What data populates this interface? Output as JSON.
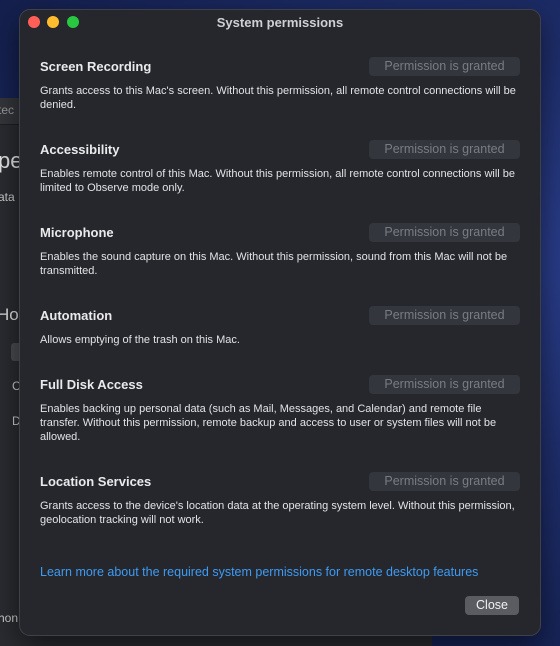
{
  "background_window": {
    "title_fragment": "tec",
    "heading_fragment": "pe",
    "line_fragment": "ata",
    "section_fragment": "Hov",
    "item1_fragment": "C",
    "item2_fragment": "D",
    "bottom_fragment": "hon"
  },
  "dialog": {
    "title": "System permissions",
    "permissions": [
      {
        "title": "Screen Recording",
        "status": "Permission is granted",
        "description": "Grants access to this Mac's screen. Without this permission, all remote control connections will be denied."
      },
      {
        "title": "Accessibility",
        "status": "Permission is granted",
        "description": "Enables remote control of this Mac. Without this permission, all remote control connections will be limited to Observe mode only."
      },
      {
        "title": "Microphone",
        "status": "Permission is granted",
        "description": "Enables the sound capture on this Mac. Without this permission, sound from this Mac will not be transmitted."
      },
      {
        "title": "Automation",
        "status": "Permission is granted",
        "description": "Allows emptying of the trash on this Mac."
      },
      {
        "title": "Full Disk Access",
        "status": "Permission is granted",
        "description": "Enables backing up personal data (such as Mail, Messages, and Calendar) and remote file transfer. Without this permission, remote backup and access to user or system files will not be allowed."
      },
      {
        "title": "Location Services",
        "status": "Permission is granted",
        "description": "Grants access to the device's location data at the operating system level. Without this permission, geolocation tracking will not work."
      }
    ],
    "learn_more_link": "Learn more about the required system permissions for remote desktop features",
    "close_label": "Close"
  }
}
